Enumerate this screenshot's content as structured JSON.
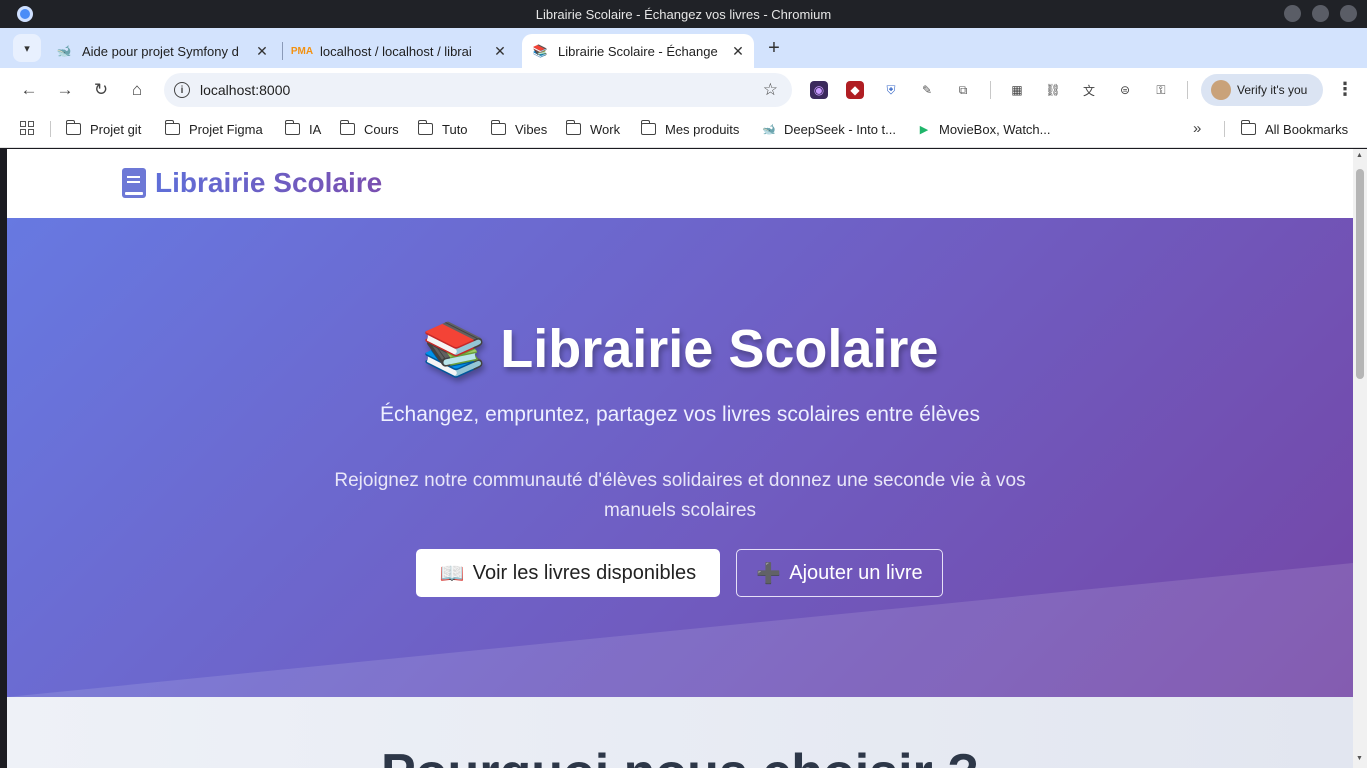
{
  "window": {
    "title": "Librairie Scolaire - Échangez vos livres - Chromium"
  },
  "tabs": [
    {
      "title": "Aide pour projet Symfony d",
      "active": false
    },
    {
      "title": "localhost / localhost / librai",
      "active": false
    },
    {
      "title": "Librairie Scolaire - Échange",
      "active": true
    }
  ],
  "toolbar": {
    "url": "localhost:8000",
    "verify_label": "Verify it's you"
  },
  "bookmarks": [
    {
      "label": "Projet git",
      "icon": "folder-icon"
    },
    {
      "label": "Projet Figma",
      "icon": "folder-icon"
    },
    {
      "label": "IA",
      "icon": "folder-icon"
    },
    {
      "label": "Cours",
      "icon": "folder-icon"
    },
    {
      "label": "Tuto",
      "icon": "folder-icon"
    },
    {
      "label": "Vibes",
      "icon": "folder-icon"
    },
    {
      "label": "Work",
      "icon": "folder-icon"
    },
    {
      "label": "Mes produits",
      "icon": "folder-icon"
    },
    {
      "label": "DeepSeek - Into t...",
      "icon": "deepseek-icon"
    },
    {
      "label": "MovieBox, Watch...",
      "icon": "moviebox-icon"
    }
  ],
  "bookmarks_all": "All Bookmarks",
  "site": {
    "brand": "Librairie Scolaire",
    "hero": {
      "emoji": "📚",
      "title": "Librairie Scolaire",
      "subtitle": "Échangez, empruntez, partagez vos livres scolaires entre élèves",
      "description": "Rejoignez notre communauté d'élèves solidaires et donnez une seconde vie à vos manuels scolaires",
      "primary_emoji": "📖",
      "primary_label": "Voir les livres disponibles",
      "secondary_emoji": "➕",
      "secondary_label": "Ajouter un livre"
    },
    "features_title": "Pourquoi nous choisir ?"
  },
  "colors": {
    "hero_start": "#6779e1",
    "hero_end": "#7446a6",
    "brand": "#6d78d6"
  }
}
